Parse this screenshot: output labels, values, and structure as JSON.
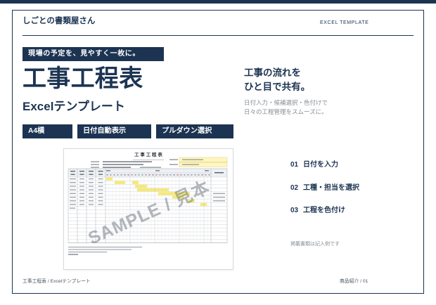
{
  "header": {
    "brand": "しごとの書類屋さん",
    "category": "EXCEL TEMPLATE"
  },
  "banner": {
    "catchphrase": "現場の予定を、見やすく一枚に。"
  },
  "title": {
    "main": "工事工程表",
    "sub": "Excelテンプレート"
  },
  "tags": [
    {
      "label": "A4横"
    },
    {
      "label": "日付自動表示"
    },
    {
      "label": "プルダウン選択"
    }
  ],
  "preview": {
    "sheet_title": "工 事 工 程 表",
    "watermark": "SAMPLE / 見本"
  },
  "headline": {
    "lines": [
      "工事の流れを",
      "ひと目で共有。"
    ]
  },
  "description": {
    "lines": [
      "日付入力・候補選択・色付けで",
      "日々の工程管理をスムーズに。"
    ]
  },
  "steps": [
    {
      "number": "01",
      "label": "日付を入力"
    },
    {
      "number": "02",
      "label": "工種・担当を選択"
    },
    {
      "number": "03",
      "label": "工程を色付け"
    }
  ],
  "note": "掲載書類は記入例です",
  "footer": {
    "left": "工事工程表 / Excelテンプレート",
    "right": "商品紹介 / 01"
  },
  "colors": {
    "navy": "#1c3452",
    "text_gray": "#868c94",
    "highlight": "#f8ea6e"
  }
}
